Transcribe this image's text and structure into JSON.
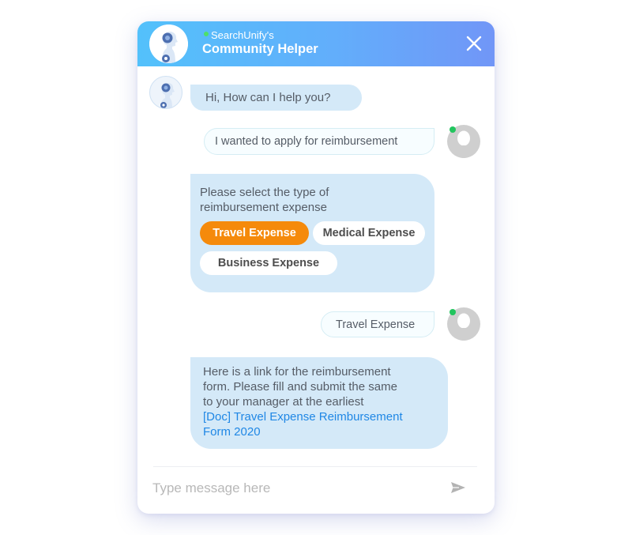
{
  "header": {
    "brand": "SearchUnify's",
    "title": "Community Helper",
    "status": "online",
    "icons": {
      "avatar": "robot-avatar-icon",
      "close": "close-icon"
    }
  },
  "messages": [
    {
      "sender": "bot",
      "text": "Hi, How can I help you?"
    },
    {
      "sender": "user",
      "text": "I wanted to apply for reimbursement"
    },
    {
      "sender": "bot",
      "text_lines": [
        "Please select the type of",
        "reimbursement expense"
      ],
      "options": [
        {
          "label": "Travel Expense",
          "selected": true
        },
        {
          "label": "Medical Expense",
          "selected": false
        },
        {
          "label": "Business Expense",
          "selected": false
        }
      ]
    },
    {
      "sender": "user",
      "text": "Travel Expense"
    },
    {
      "sender": "bot",
      "text_lines": [
        "Here is a link for the reimbursement",
        "form. Please fill and submit the same",
        "to your manager at the earliest"
      ],
      "link_lines": [
        "[Doc] Travel Expense Reimbursement",
        "Form 2020"
      ]
    }
  ],
  "composer": {
    "placeholder": "Type message here",
    "value": "",
    "send_icon": "send-icon"
  },
  "colors": {
    "header_gradient_start": "#53c1fb",
    "header_gradient_end": "#7196f7",
    "bot_bubble": "#d4e9f8",
    "selected_option": "#f58a0b",
    "link": "#1f87e5",
    "online": "#22c55e"
  }
}
